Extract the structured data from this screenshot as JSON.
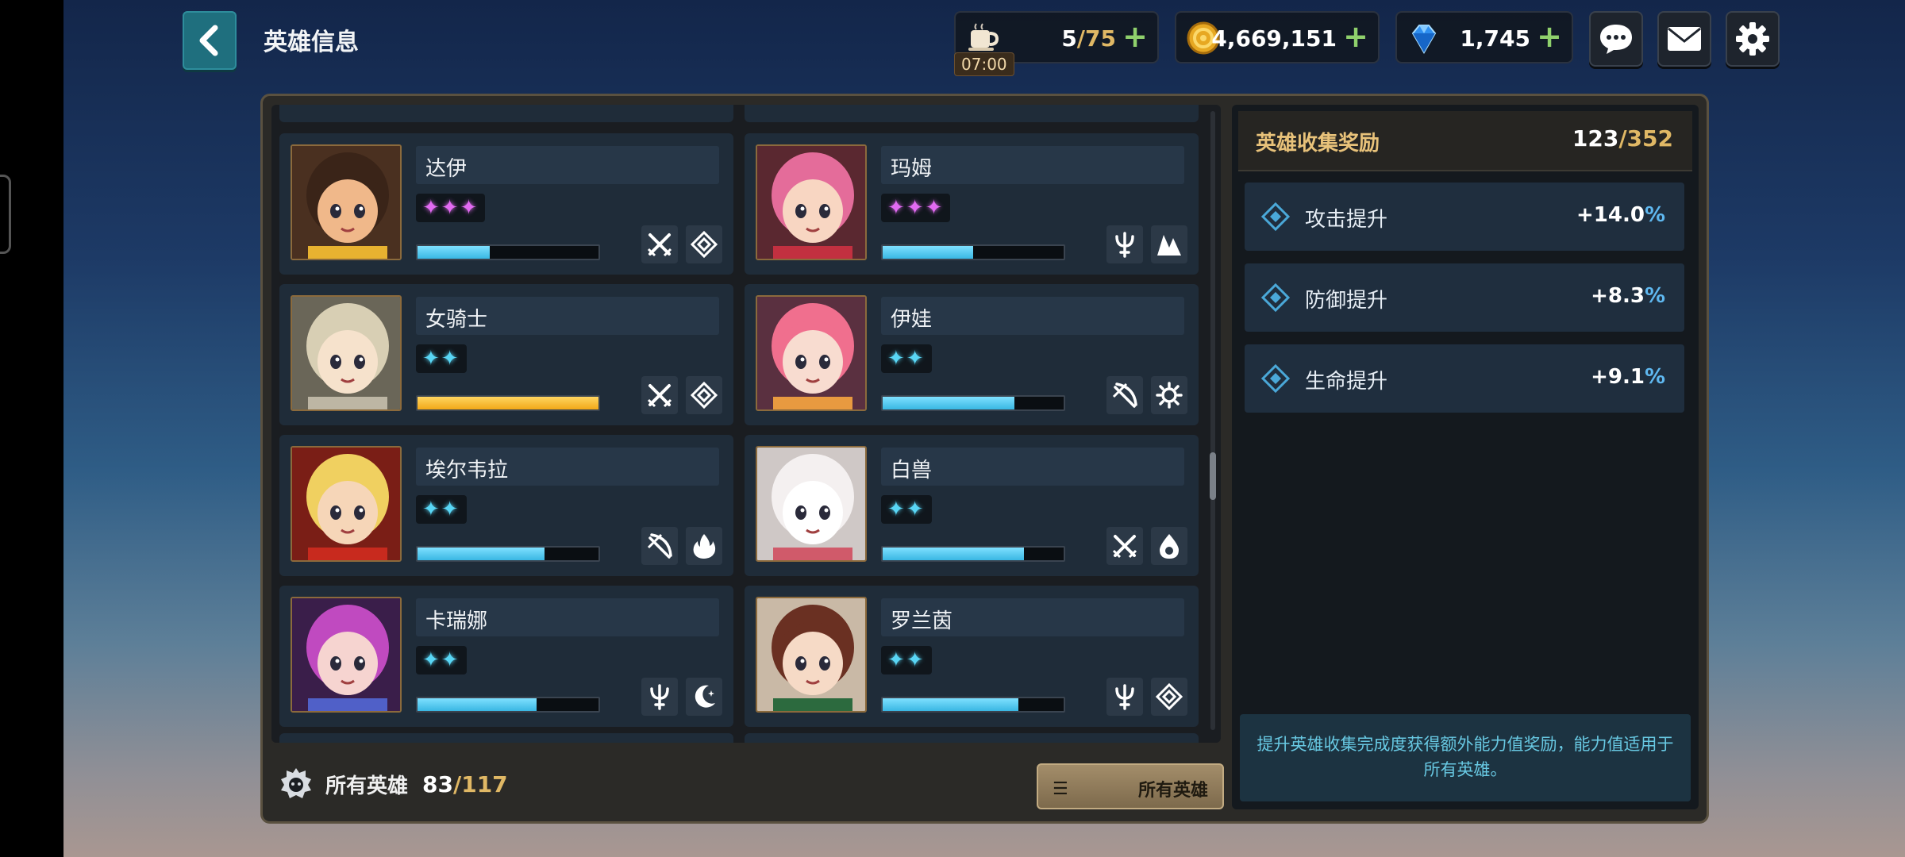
{
  "header": {
    "back_icon": "chevron-left-icon",
    "title": "英雄信息"
  },
  "resources": {
    "stamina": {
      "icon": "coffee-cup-icon",
      "current": "5",
      "max": "/75",
      "timer": "07:00"
    },
    "gold": {
      "icon": "gold-coin-icon",
      "value": "4,669,151"
    },
    "gems": {
      "icon": "blue-diamond-icon",
      "value": "1,745"
    },
    "plus": "+"
  },
  "toolbar": {
    "chat_icon": "chat-bubble-icon",
    "mail_icon": "mail-icon",
    "settings_icon": "gear-icon"
  },
  "heroes": [
    {
      "name": "达伊",
      "stars": "✦✦✦",
      "star_color": "#e26bf2",
      "progress": 0.4,
      "bar": "blue",
      "classes": [
        "crossed-swords-icon",
        "diamond-rune-icon"
      ]
    },
    {
      "name": "玛姆",
      "stars": "✦✦✦",
      "star_color": "#e26bf2",
      "progress": 0.5,
      "bar": "blue",
      "classes": [
        "trident-icon",
        "mountain-claw-icon"
      ]
    },
    {
      "name": "女骑士",
      "stars": "✦✦",
      "star_color": "#59d6f5",
      "progress": 1.0,
      "bar": "gold",
      "classes": [
        "crossed-swords-icon",
        "diamond-rune-icon"
      ]
    },
    {
      "name": "伊娃",
      "stars": "✦✦",
      "star_color": "#59d6f5",
      "progress": 0.73,
      "bar": "blue",
      "classes": [
        "bow-icon",
        "sun-gear-icon"
      ]
    },
    {
      "name": "埃尔韦拉",
      "stars": "✦✦",
      "star_color": "#59d6f5",
      "progress": 0.7,
      "bar": "blue",
      "classes": [
        "bow-icon",
        "fire-icon"
      ]
    },
    {
      "name": "白兽",
      "stars": "✦✦",
      "star_color": "#59d6f5",
      "progress": 0.78,
      "bar": "blue",
      "classes": [
        "crossed-swords-icon",
        "water-drop-icon"
      ]
    },
    {
      "name": "卡瑞娜",
      "stars": "✦✦",
      "star_color": "#59d6f5",
      "progress": 0.66,
      "bar": "blue",
      "classes": [
        "trident-icon",
        "crescent-moon-icon"
      ]
    },
    {
      "name": "罗兰茵",
      "stars": "✦✦",
      "star_color": "#59d6f5",
      "progress": 0.75,
      "bar": "blue",
      "classes": [
        "trident-icon",
        "diamond-rune-icon"
      ]
    }
  ],
  "footer": {
    "icon": "hero-crest-icon",
    "label": "所有英雄",
    "owned": "83",
    "total": "/117",
    "filter_label": "所有英雄",
    "filter_icon": "list-lines-icon"
  },
  "collection": {
    "title": "英雄收集奖励",
    "current": "123",
    "total": "/352",
    "bonuses": [
      {
        "label": "攻击提升",
        "value": "+14.0",
        "unit": "%"
      },
      {
        "label": "防御提升",
        "value": "+8.3",
        "unit": "%"
      },
      {
        "label": "生命提升",
        "value": "+9.1",
        "unit": "%"
      }
    ],
    "description": "提升英雄收集完成度获得额外能力值奖励，能力值适用于所有英雄。"
  },
  "colors": {
    "accent_teal": "#1f6f7e",
    "gold_text": "#e0b865",
    "percent_blue": "#5fb8f0",
    "bar_blue": "#39b7e3",
    "bar_gold": "#f2a818"
  }
}
